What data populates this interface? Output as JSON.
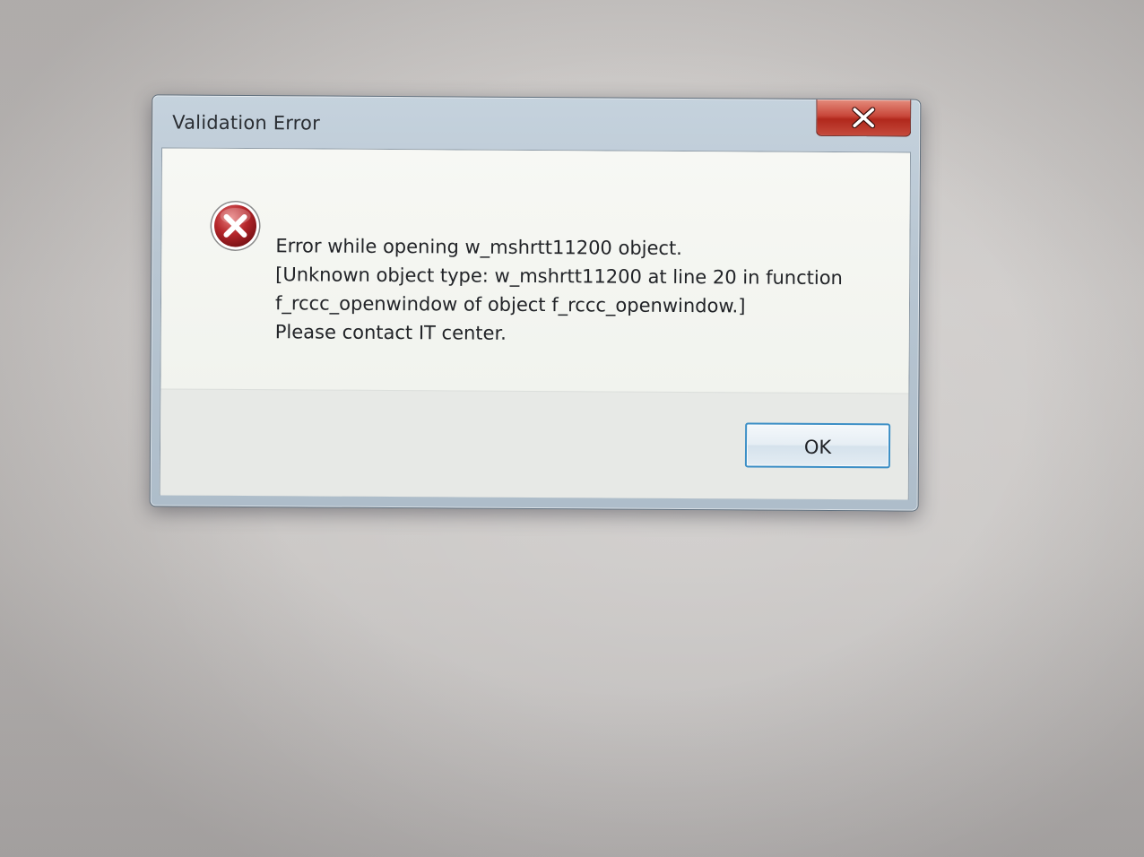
{
  "dialog": {
    "title": "Validation Error",
    "message_lines": [
      "Error while opening w_mshrtt11200 object.",
      "[Unknown object type: w_mshrtt11200 at line 20 in function",
      "f_rccc_openwindow of object f_rccc_openwindow.]",
      "Please contact IT center."
    ],
    "ok_label": "OK",
    "close_icon": "close-icon",
    "status_icon": "error-icon"
  },
  "colors": {
    "close_button": "#c8473a",
    "error_icon": "#b1282c",
    "ok_border": "#3c8fc6"
  }
}
